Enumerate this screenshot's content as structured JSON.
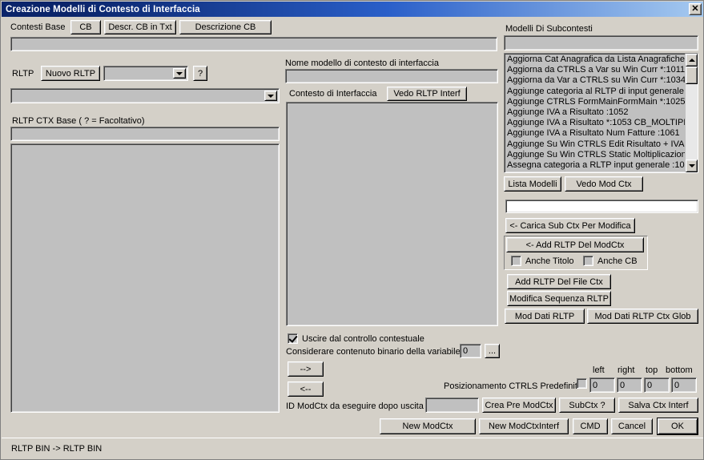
{
  "window": {
    "title": "Creazione Modelli di Contesto di Interfaccia",
    "close_label": "✕"
  },
  "left": {
    "contesti_base_label": "Contesti Base",
    "btn_cb": "CB",
    "btn_descr_cb_txt": "Descr. CB in Txt",
    "btn_descrizione_cb": "Descrizione CB",
    "contesti_base_value": "",
    "rltp_label": "RLTP",
    "btn_nuovo_rltp": "Nuovo RLTP",
    "rltp_combo_value": "",
    "btn_help": "?",
    "rltp_list_combo_value": "",
    "rltp_ctx_base_label": "RLTP CTX Base ( ? = Facoltativo)",
    "rltp_ctx_base_value": "",
    "rltp_ctx_big_value": ""
  },
  "middle": {
    "nome_modello_label": "Nome modello di contesto di interfaccia",
    "nome_modello_value": "",
    "contesto_interfaccia_label": "Contesto di Interfaccia",
    "btn_vedo_rltp_interf": "Vedo RLTP Interf",
    "contesto_interfaccia_value": "",
    "chk_uscire_label": "Uscire dal controllo contestuale",
    "chk_uscire_checked": true,
    "considerare_label": "Considerare contenuto binario della variabile",
    "considerare_value": "0",
    "btn_ellipsis": "...",
    "btn_arrow_right": "-->",
    "btn_arrow_left": "<--",
    "id_modctx_label": "ID ModCtx da eseguire dopo uscita",
    "id_modctx_value": ""
  },
  "right": {
    "modelli_subcontesti_label": "Modelli Di Subcontesti",
    "search_value": "",
    "list_items": [
      "Aggiorna Cat Anagrafica da Lista Anagrafiche",
      "Aggiorna da CTRLS  a Var su Win Curr *:1011",
      "Aggiorna da Var a CTRLS  su Win Curr *:1034",
      "Aggiunge categoria al RLTP di input generale",
      "Aggiunge CTRLS FormMainFormMain *:1025 ",
      "Aggiunge IVA a Risultato  :1052",
      "Aggiunge IVA a Risultato *:1053 CB_MOLTIPL",
      "Aggiunge IVA a Risultato Num Fatture  :1061",
      "Aggiunge Su Win CTRLS Edit Risultato + IVA",
      "Aggiunge Su Win CTRLS Static Moltiplicazion",
      "Assegna categoria a RLTP input generale  :10"
    ],
    "btn_lista_modelli": "Lista Modelli",
    "btn_vedo_mod_ctx": "Vedo Mod Ctx",
    "field_value": "",
    "btn_carica_sub_ctx": "<- Carica Sub Ctx Per Modifica",
    "btn_add_rltp_modctx": "<- Add RLTP Del ModCtx",
    "chk_anche_titolo": "Anche Titolo",
    "chk_anche_cb": "Anche CB",
    "btn_add_rltp_file_ctx": "Add RLTP Del File Ctx",
    "btn_modifica_sequenza": "Modifica Sequenza RLTP",
    "btn_mod_dati_rltp": "Mod Dati RLTP",
    "btn_mod_dati_rltp_glob": "Mod Dati RLTP Ctx Glob"
  },
  "positioning": {
    "label": "Posizionamento CTRLS Predefinito",
    "checked": false,
    "left_label": "left",
    "right_label": "right",
    "top_label": "top",
    "bottom_label": "bottom",
    "left_value": "0",
    "right_value": "0",
    "top_value": "0",
    "bottom_value": "0"
  },
  "actions": {
    "btn_crea_pre_modctx": "Crea Pre ModCtx",
    "btn_subctx": "SubCtx ?",
    "btn_salva_ctx_interf": "Salva Ctx Interf",
    "btn_new_modctx": "New ModCtx",
    "btn_new_modctxinterf": "New ModCtxInterf",
    "btn_cmd": "CMD",
    "btn_cancel": "Cancel",
    "btn_ok": "OK"
  },
  "statusbar": {
    "text": "RLTP BIN -> RLTP BIN"
  },
  "colors": {
    "face": "#d4d0c8",
    "title_start": "#0a246a",
    "title_end": "#a6caf0",
    "field": "#c0c0c0"
  }
}
